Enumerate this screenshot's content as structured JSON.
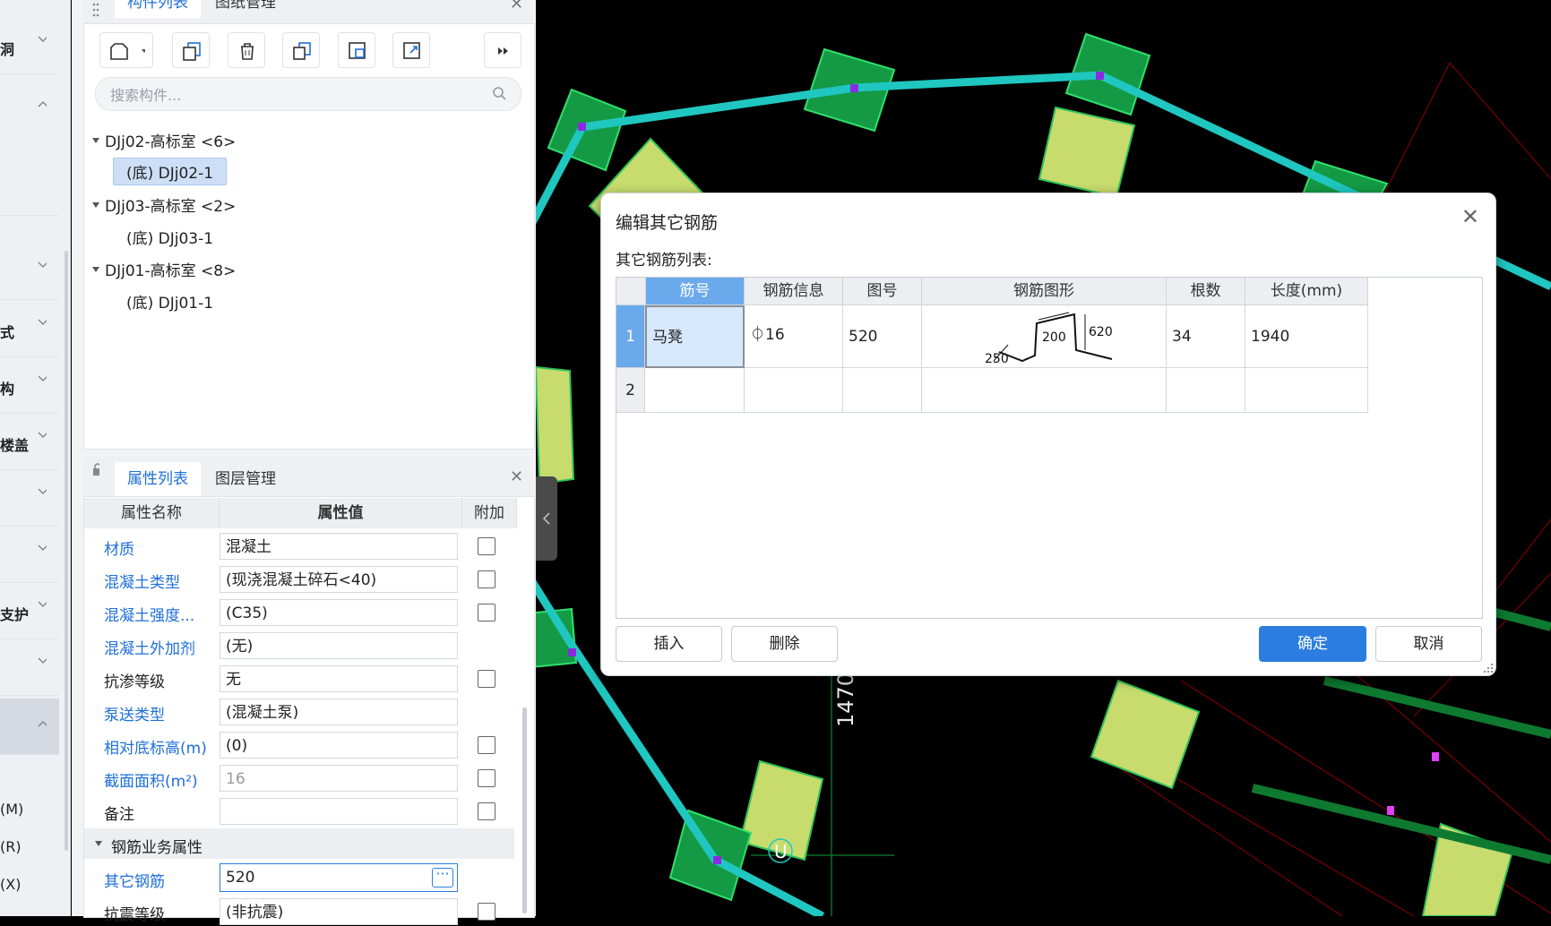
{
  "left_nav": {
    "items": [
      {
        "label": "洞"
      },
      {
        "label": ""
      },
      {
        "label": ""
      },
      {
        "label": "式"
      },
      {
        "label": "构"
      },
      {
        "label": "楼盖"
      },
      {
        "label": ""
      },
      {
        "label": ""
      },
      {
        "label": "支护"
      },
      {
        "label": ""
      },
      {
        "label": ""
      }
    ],
    "letters": [
      "(M)",
      "(R)",
      "(X)"
    ]
  },
  "component_panel": {
    "tabs": [
      "构件列表",
      "图纸管理"
    ],
    "search_placeholder": "搜索构件...",
    "tree": [
      {
        "label": "DJj02-高标室 <6>",
        "child": "(底) DJj02-1"
      },
      {
        "label": "DJj03-高标室 <2>",
        "child": "(底) DJj03-1"
      },
      {
        "label": "DJj01-高标室 <8>",
        "child": "(底) DJj01-1"
      }
    ]
  },
  "property_panel": {
    "tabs": [
      "属性列表",
      "图层管理"
    ],
    "headers": [
      "属性名称",
      "属性值",
      "附加"
    ],
    "rows": [
      {
        "name": "材质",
        "value": "混凝土"
      },
      {
        "name": "混凝土类型",
        "value": "(现浇混凝土碎石<40)"
      },
      {
        "name": "混凝土强度...",
        "value": "(C35)"
      },
      {
        "name": "混凝土外加剂",
        "value": "(无)"
      },
      {
        "name": "抗渗等级",
        "value": "无"
      },
      {
        "name": "泵送类型",
        "value": "(混凝土泵)"
      },
      {
        "name": "相对底标高(m)",
        "value": "(0)"
      },
      {
        "name": "截面面积(m²)",
        "value": "16"
      },
      {
        "name": "备注",
        "value": ""
      }
    ],
    "group": "钢筋业务属性",
    "other_rebar": {
      "name": "其它钢筋",
      "value": "520"
    },
    "last_row": {
      "name": "抗震等级",
      "value": "(非抗震)"
    }
  },
  "canvas": {
    "dim_label": "1470",
    "marker": "U"
  },
  "dialog": {
    "title": "编辑其它钢筋",
    "subtitle": "其它钢筋列表:",
    "columns": [
      "筋号",
      "钢筋信息",
      "图号",
      "钢筋图形",
      "根数",
      "长度(mm)"
    ],
    "rows": [
      {
        "num": "1",
        "name": "马凳",
        "info": "⏀16",
        "fig": "520",
        "count": "34",
        "length": "1940"
      },
      {
        "num": "2",
        "name": "",
        "info": "",
        "fig": "",
        "count": "",
        "length": ""
      }
    ],
    "shape_dims": {
      "a": "200",
      "b": "620",
      "c": "250"
    },
    "buttons": {
      "insert": "插入",
      "delete": "删除",
      "ok": "确定",
      "cancel": "取消"
    }
  },
  "colors": {
    "accent": "#2b7de0",
    "beam": "#1fc7c0",
    "pad_dark": "#1a9e48",
    "pad_light": "#c8dc6e",
    "grid_red": "#8b0000"
  }
}
